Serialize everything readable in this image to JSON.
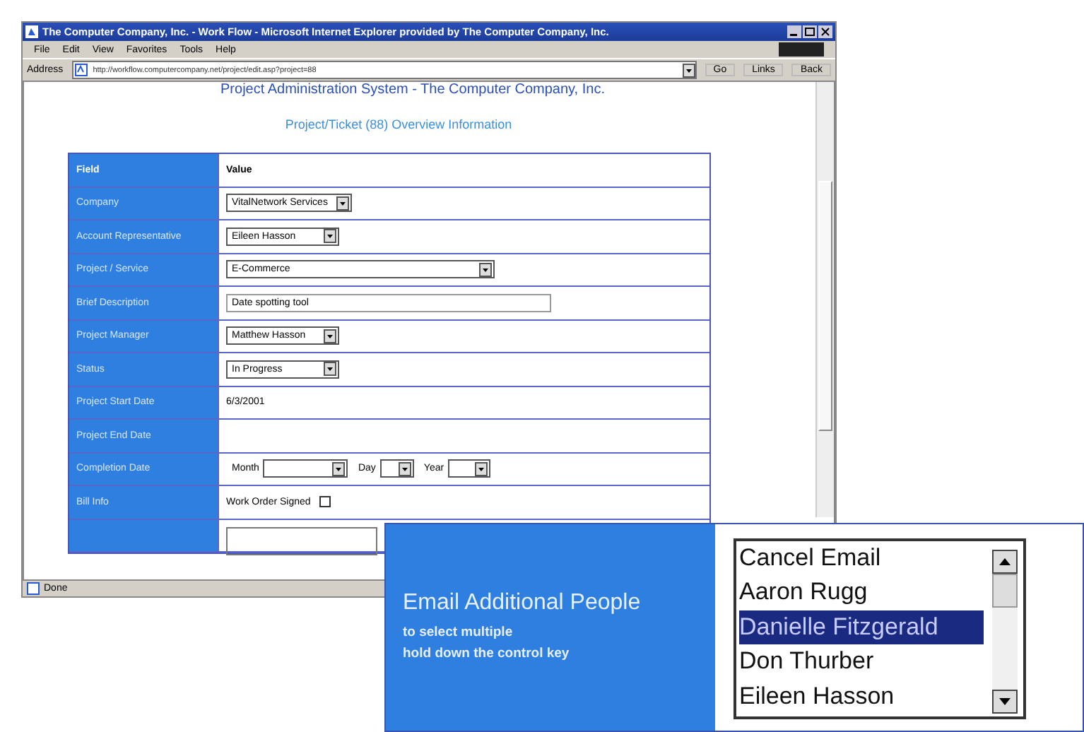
{
  "window": {
    "title": "The Computer Company, Inc. - Work Flow - Microsoft Internet Explorer provided by The Computer Company, Inc."
  },
  "menu": [
    "File",
    "Edit",
    "View",
    "Favorites",
    "Tools",
    "Help"
  ],
  "address_bar": {
    "label": "Address",
    "url": "http://workflow.computercompany.net/project/edit.asp?project=88",
    "buttons": [
      "Go",
      "Links",
      "Back"
    ]
  },
  "page": {
    "heading": "Project Administration System - The Computer Company, Inc.",
    "subheading": "Project/Ticket (88) Overview Information"
  },
  "table": {
    "columns": [
      "Field",
      "Value"
    ],
    "rows": [
      {
        "label": "Company",
        "kind": "select",
        "value": "VitalNetwork Services"
      },
      {
        "label": "Account Representative",
        "kind": "select",
        "value": "Eileen Hasson"
      },
      {
        "label": "Project / Service",
        "kind": "select",
        "value": "E-Commerce"
      },
      {
        "label": "Brief Description",
        "kind": "text",
        "value": "Date spotting tool"
      },
      {
        "label": "Project Manager",
        "kind": "select",
        "value": "Matthew Hasson"
      },
      {
        "label": "Status",
        "kind": "select",
        "value": "In Progress"
      },
      {
        "label": "Project Start Date",
        "kind": "static",
        "value": "6/3/2001"
      },
      {
        "label": "Project End Date",
        "kind": "static"
      },
      {
        "label": "Completion Date",
        "kind": "date",
        "parts": [
          "Month",
          "Day",
          "Year"
        ]
      },
      {
        "label": "Bill Info",
        "kind": "checkbox",
        "value": "Work Order Signed",
        "checked": false
      },
      {
        "kind": "textarea"
      }
    ]
  },
  "status_bar": {
    "text": "Done"
  },
  "inset": {
    "title": "Email Additional People",
    "hints": [
      "to select multiple",
      "hold down the control key"
    ],
    "list": [
      {
        "label": "Cancel Email",
        "selected": false
      },
      {
        "label": "Aaron Rugg",
        "selected": false
      },
      {
        "label": "Danielle Fitzgerald",
        "selected": true
      },
      {
        "label": "Don Thurber",
        "selected": false
      },
      {
        "label": "Eileen Hasson",
        "selected": false
      }
    ]
  }
}
